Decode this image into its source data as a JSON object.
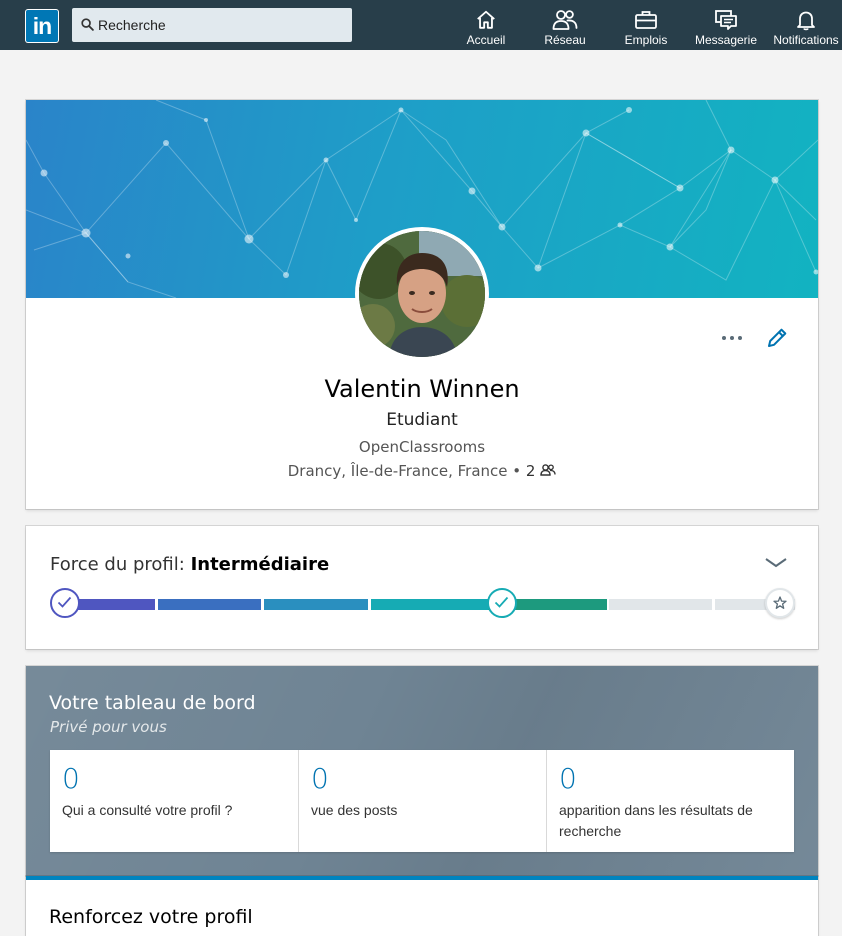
{
  "nav": {
    "logo_text": "in",
    "search_placeholder": "Recherche",
    "items": [
      {
        "label": "Accueil",
        "icon": "home-icon"
      },
      {
        "label": "Réseau",
        "icon": "network-icon"
      },
      {
        "label": "Emplois",
        "icon": "briefcase-icon"
      },
      {
        "label": "Messagerie",
        "icon": "messaging-icon"
      },
      {
        "label": "Notifications",
        "icon": "bell-icon"
      }
    ]
  },
  "profile": {
    "name": "Valentin Winnen",
    "headline": "Etudiant",
    "company": "OpenClassrooms",
    "location": "Drancy, Île-de-France, France",
    "separator": "•",
    "connections": "2"
  },
  "strength": {
    "label": "Force du profil:",
    "level": "Intermédiaire",
    "achieved_steps": 5,
    "total_steps": 7
  },
  "dashboard": {
    "title": "Votre tableau de bord",
    "subtitle": "Privé pour vous",
    "stats": [
      {
        "value": "0",
        "label": "Qui a consulté votre profil ?"
      },
      {
        "value": "0",
        "label": "vue des posts"
      },
      {
        "value": "0",
        "label": "apparition dans les résultats de recherche"
      }
    ]
  },
  "next_section": {
    "title": "Renforcez votre profil"
  },
  "colors": {
    "nav_bg": "#283e4a",
    "brand_blue": "#0077b5",
    "link_blue": "#0073b1",
    "dashboard_bg": "#6f8494"
  }
}
